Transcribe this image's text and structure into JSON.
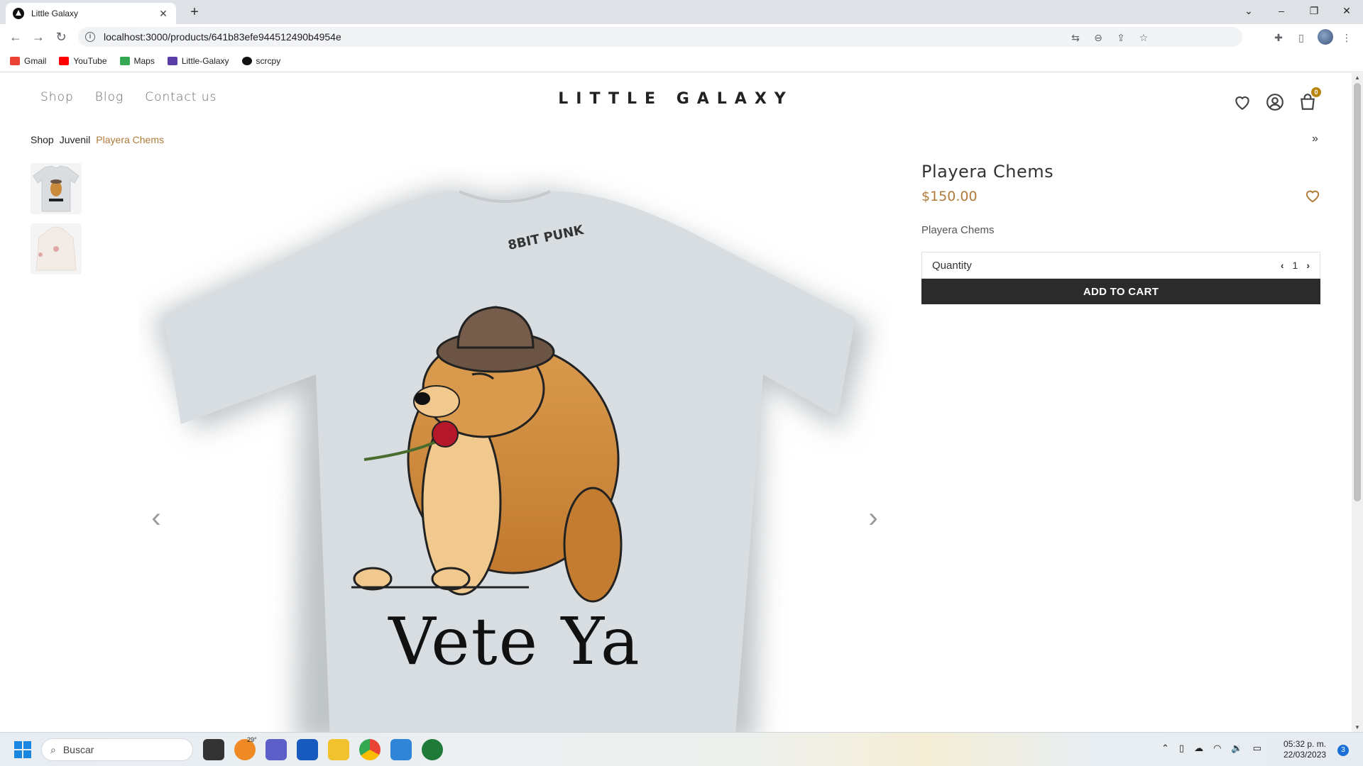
{
  "browser": {
    "tab_title": "Little Galaxy",
    "url": "localhost:3000/products/641b83efe944512490b4954e",
    "bookmarks": [
      {
        "label": "Gmail",
        "color": "#ea4335"
      },
      {
        "label": "YouTube",
        "color": "#ff0000"
      },
      {
        "label": "Maps",
        "color": "#34a853"
      },
      {
        "label": "Little-Galaxy",
        "color": "#5b3fa8"
      },
      {
        "label": "scrcpy",
        "color": "#111111"
      }
    ]
  },
  "site": {
    "nav": [
      "Shop",
      "Blog",
      "Contact us"
    ],
    "logo": "LITTLE GALAXY",
    "cart_count": "0",
    "accent": "#b07a3a"
  },
  "breadcrumb": [
    "Shop",
    "Juvenil",
    "Playera Chems"
  ],
  "product": {
    "name": "Playera Chems",
    "price": "$150.00",
    "description": "Playera Chems",
    "quantity_label": "Quantity",
    "quantity": "1",
    "add_to_cart": "ADD TO CART",
    "shirt_back_text": "8BIT\nPUNK",
    "shirt_print_text": "Vete Ya"
  },
  "taskbar": {
    "search_placeholder": "Buscar",
    "weather": "29°",
    "time": "05:32 p. m.",
    "date": "22/03/2023",
    "notifications": "3"
  }
}
